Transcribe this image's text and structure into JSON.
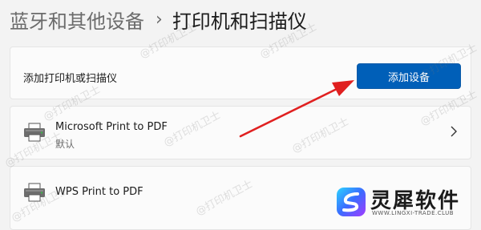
{
  "breadcrumb": {
    "parent": "蓝牙和其他设备",
    "separator": "›",
    "current": "打印机和扫描仪"
  },
  "add_section": {
    "label": "添加打印机或扫描仪",
    "button_label": "添加设备"
  },
  "printers": [
    {
      "name": "Microsoft Print to PDF",
      "status": "默认",
      "icon": "printer-icon"
    },
    {
      "name": "WPS Print to PDF",
      "icon": "printer-icon"
    }
  ],
  "watermark": {
    "text": "@打印机卫士"
  },
  "brand": {
    "name": "灵犀软件",
    "url": "WWW.LINGXI-TRADE.CLUB"
  },
  "colors": {
    "accent": "#005fb8",
    "arrow": "#e02020",
    "background": "#f3f3f3",
    "card": "#fbfbfb"
  }
}
